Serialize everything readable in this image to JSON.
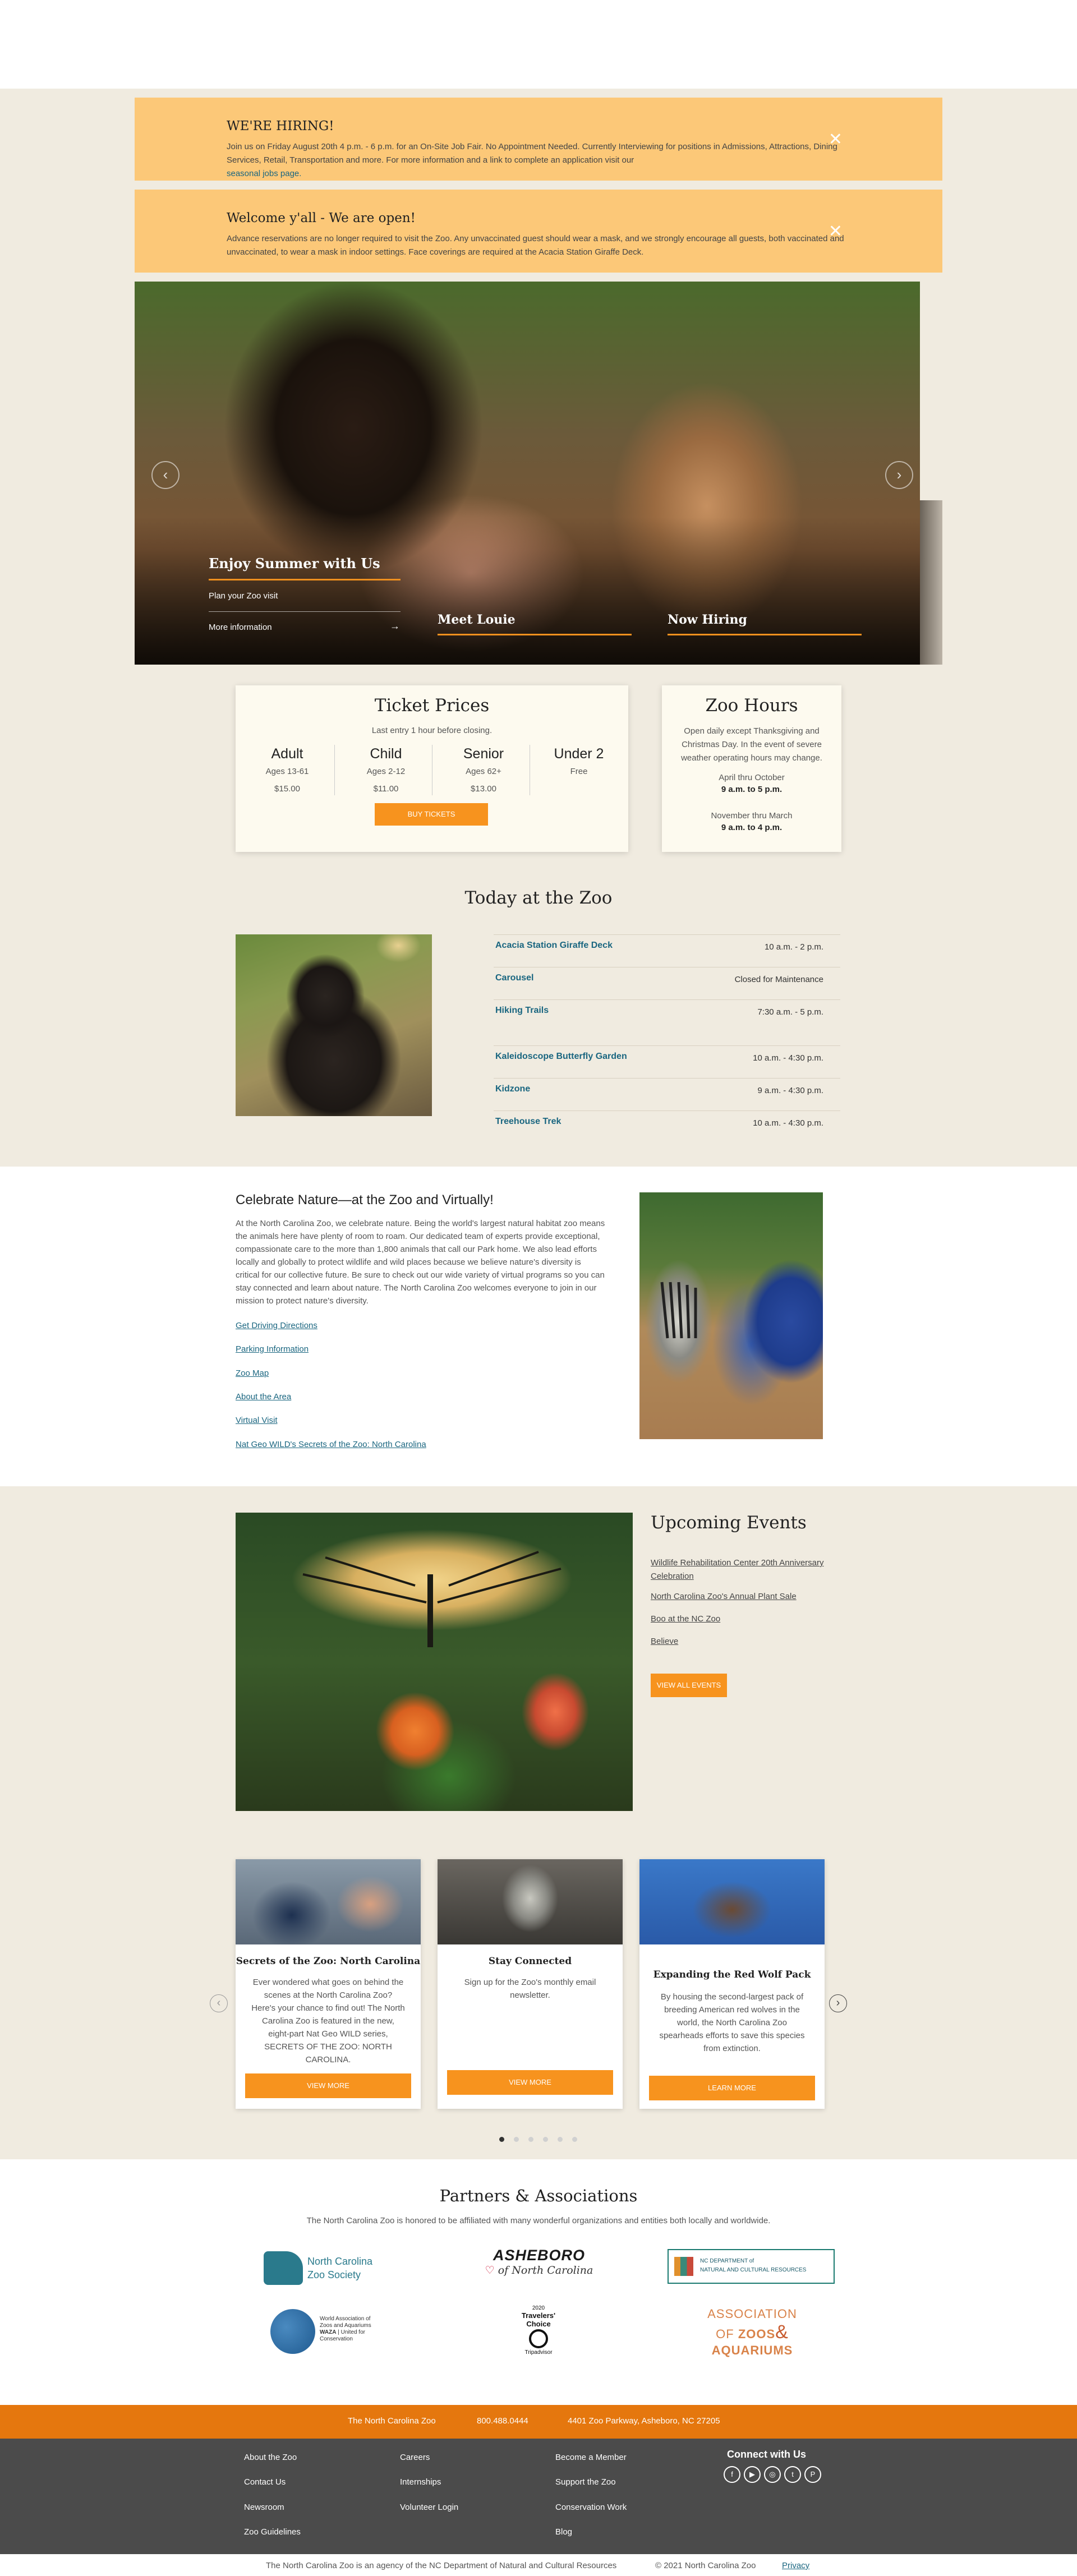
{
  "alerts": [
    {
      "title": "WE'RE HIRING!",
      "body": "Join us on Friday August 20th 4 p.m. - 6 p.m. for an On-Site Job Fair.  No Appointment Needed.  Currently Interviewing for positions in Admissions, Attractions, Dining Services, Retail, Transportation and more.   For more information and a link to complete an application visit our",
      "link": "seasonal jobs page.",
      "close": "✕"
    },
    {
      "title": "Welcome y'all - We are open!",
      "body": "Advance reservations are no longer required to visit the Zoo.  Any unvaccinated guest should wear a mask, and we strongly encourage all guests, both vaccinated and unvaccinated, to wear a mask in indoor settings. Face coverings are required at the Acacia Station Giraffe Deck.",
      "close": "✕"
    }
  ],
  "hero": {
    "main_title": "Enjoy Summer with Us",
    "links": [
      "Plan your Zoo visit",
      "More information"
    ],
    "link_arrow": "→",
    "slides": [
      "Meet Louie",
      "Now Hiring"
    ],
    "prev": "‹",
    "next": "›"
  },
  "tickets": {
    "title": "Ticket Prices",
    "note": "Last entry 1 hour before closing.",
    "types": [
      {
        "name": "Adult",
        "ages": "Ages 13-61",
        "price": "$15.00"
      },
      {
        "name": "Child",
        "ages": "Ages 2-12",
        "price": "$11.00"
      },
      {
        "name": "Senior",
        "ages": "Ages 62+",
        "price": "$13.00"
      },
      {
        "name": "Under 2",
        "ages": "Free",
        "price": ""
      }
    ],
    "button": "BUY TICKETS"
  },
  "hours": {
    "title": "Zoo Hours",
    "note": "Open daily except Thanksgiving and Christmas Day. In the event of severe weather operating hours may change.",
    "season1": "April thru October",
    "time1": "9 a.m. to 5 p.m.",
    "season2": "November thru March",
    "time2": "9 a.m. to 4 p.m."
  },
  "today": {
    "title": "Today at the Zoo",
    "rows": [
      {
        "name": "Acacia Station Giraffe Deck",
        "time": "10 a.m. - 2 p.m."
      },
      {
        "name": "Carousel",
        "time": "Closed for Maintenance"
      },
      {
        "name": "Hiking Trails",
        "time": "7:30 a.m. - 5 p.m."
      },
      {
        "name": "Kaleidoscope Butterfly Garden",
        "time": "10 a.m. - 4:30 p.m."
      },
      {
        "name": "Kidzone",
        "time": "9 a.m. - 4:30 p.m."
      },
      {
        "name": "Treehouse Trek",
        "time": "10 a.m. - 4:30 p.m."
      }
    ]
  },
  "celebrate": {
    "title": "Celebrate Nature—at the Zoo and Virtually!",
    "body": "At the North Carolina Zoo, we celebrate nature. Being the world's largest natural habitat zoo means the animals here have plenty of room to roam. Our dedicated team of experts provide exceptional, compassionate care to the more than 1,800 animals that call our Park home. We also lead efforts locally and globally to protect wildlife and wild places because we believe nature's diversity is critical for our collective future. Be sure to check out our wide variety of virtual programs so you can stay connected and learn about nature. The North Carolina Zoo welcomes everyone to join in our mission to protect nature's diversity.",
    "links": [
      "Get Driving Directions",
      "Parking Information",
      "Zoo Map",
      "About the Area",
      "Virtual Visit",
      "Nat Geo WILD's Secrets of the Zoo: North Carolina"
    ]
  },
  "events": {
    "title": "Upcoming Events",
    "items": [
      "Wildlife Rehabilitation Center 20th Anniversary Celebration",
      "North Carolina Zoo's Annual Plant Sale",
      "Boo at the NC Zoo",
      "Believe"
    ],
    "button": "VIEW ALL EVENTS"
  },
  "promos": [
    {
      "title": "Secrets of the Zoo: North Carolina",
      "text": "Ever wondered what goes on behind the scenes at the North Carolina Zoo? Here's your chance to find out! The North Carolina Zoo is featured in the new, eight-part Nat Geo WILD series, SECRETS OF THE ZOO: NORTH CAROLINA.",
      "button": "VIEW MORE"
    },
    {
      "title": "Stay Connected",
      "text": "Sign up for the Zoo's monthly email newsletter.",
      "button": "VIEW MORE"
    },
    {
      "title": "Expanding the Red Wolf Pack",
      "text": "By housing the second-largest pack of breeding American red wolves in the world, the North Carolina Zoo spearheads efforts to save this species from extinction.",
      "button": "LEARN MORE"
    }
  ],
  "carousel": {
    "prev": "‹",
    "next": "›"
  },
  "partners": {
    "title": "Partners & Associations",
    "subtitle": "The North Carolina Zoo is honored to be affiliated with many wonderful organizations and entities both locally and worldwide.",
    "logos": {
      "zoo_society": [
        "North Carolina",
        "Zoo Society"
      ],
      "asheboro": [
        "ASHEBORO",
        "of North Carolina"
      ],
      "ncdncr": [
        "NC DEPARTMENT of",
        "NATURAL AND CULTURAL RESOURCES"
      ],
      "waza": [
        "World Association of",
        "Zoos and Aquariums",
        "WAZA",
        "United for",
        "Conservation"
      ],
      "tripadvisor": [
        "2020",
        "Travelers'",
        "Choice",
        "Tripadvisor"
      ],
      "aza": [
        "ASSOCIATION",
        "OF",
        "ZOOS",
        "AQUARIUMS",
        "&"
      ]
    }
  },
  "contact": {
    "name": "The North Carolina Zoo",
    "phone": "800.488.0444",
    "address": "4401 Zoo Parkway, Asheboro, NC 27205"
  },
  "footer": {
    "col1": [
      "About the Zoo",
      "Contact Us",
      "Newsroom",
      "Zoo Guidelines"
    ],
    "col2": [
      "Careers",
      "Internships",
      "Volunteer Login"
    ],
    "col3": [
      "Become a Member",
      "Support the Zoo",
      "Conservation Work",
      "Blog"
    ],
    "connect_title": "Connect with Us",
    "social": [
      "f",
      "▶",
      "◎",
      "t",
      "P"
    ]
  },
  "bottom": {
    "agency": "The North Carolina Zoo is an agency of the NC Department of Natural and Cultural Resources",
    "copyright": "© 2021 North Carolina Zoo",
    "privacy": "Privacy"
  },
  "colors": {
    "accent": "#f7931e",
    "alert_bg": "#fcc878",
    "link": "#1a6680",
    "footer": "#4b4b4b",
    "orange_bar": "#e5770e"
  }
}
